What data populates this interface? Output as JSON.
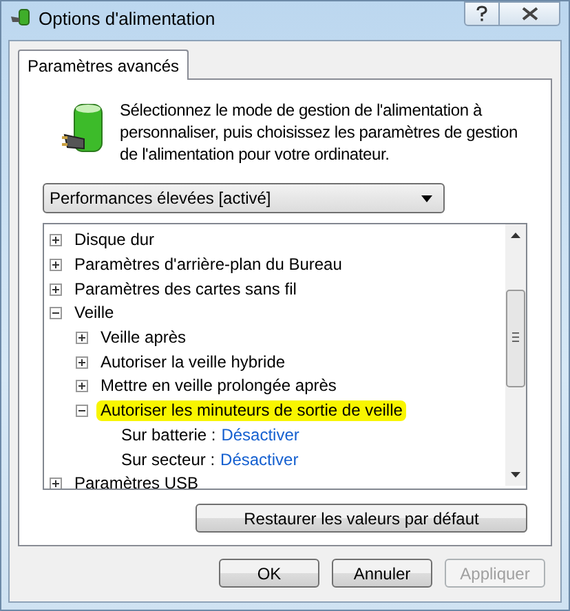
{
  "window": {
    "title": "Options d'alimentation"
  },
  "tabs": [
    {
      "label": "Paramètres avancés",
      "selected": true
    }
  ],
  "description": "Sélectionnez le mode de gestion de l'alimentation à personnaliser, puis choisissez les paramètres de gestion de l'alimentation pour votre ordinateur.",
  "plan_dropdown": {
    "value": "Performances élevées [activé]"
  },
  "tree": [
    {
      "kind": "group",
      "label": "Disque dur",
      "expanded": false,
      "selected": false
    },
    {
      "kind": "group",
      "label": "Paramètres d'arrière-plan du Bureau",
      "expanded": false,
      "selected": false
    },
    {
      "kind": "group",
      "label": "Paramètres des cartes sans fil",
      "expanded": false,
      "selected": false
    },
    {
      "kind": "group",
      "label": "Veille",
      "expanded": true,
      "selected": false,
      "children": [
        {
          "kind": "group",
          "label": "Veille après",
          "expanded": false,
          "selected": false
        },
        {
          "kind": "group",
          "label": "Autoriser la veille hybride",
          "expanded": false,
          "selected": false
        },
        {
          "kind": "group",
          "label": "Mettre en veille prolongée après",
          "expanded": false,
          "selected": false
        },
        {
          "kind": "group",
          "label": "Autoriser les minuteurs de sortie de veille",
          "expanded": true,
          "selected": true,
          "children": [
            {
              "kind": "setting",
              "label": "Sur batterie :",
              "value": "Désactiver"
            },
            {
              "kind": "setting",
              "label": "Sur secteur :",
              "value": "Désactiver"
            }
          ]
        }
      ]
    },
    {
      "kind": "group",
      "label": "Paramètres USB",
      "expanded": false,
      "selected": false
    }
  ],
  "restore_button": "Restaurer les valeurs par défaut",
  "buttons": [
    {
      "label": "OK",
      "disabled": false
    },
    {
      "label": "Annuler",
      "disabled": false
    },
    {
      "label": "Appliquer",
      "disabled": true
    }
  ]
}
